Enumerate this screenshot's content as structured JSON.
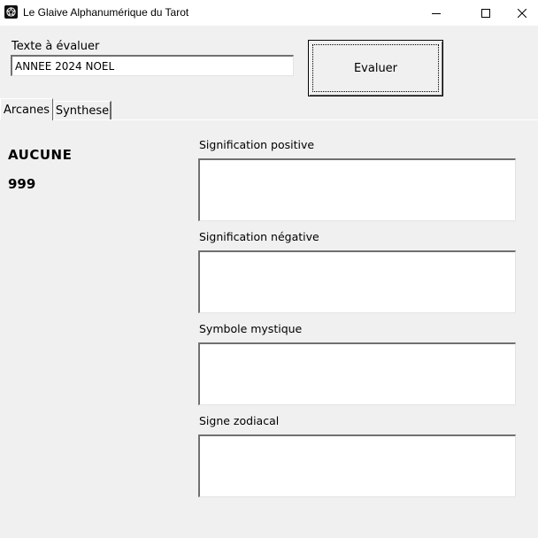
{
  "window": {
    "title": "Le Glaive Alphanumérique du Tarot",
    "icon": "tarot-star-icon",
    "controls": {
      "minimize": "minimize-icon",
      "maximize": "maximize-icon",
      "close": "close-icon"
    }
  },
  "input": {
    "label": "Texte à évaluer",
    "value": "ANNEE 2024 NOEL"
  },
  "evaluate_button": {
    "label": "Evaluer"
  },
  "tabs": [
    {
      "label": "Arcanes",
      "active": true
    },
    {
      "label": "Synthese",
      "active": false
    }
  ],
  "arcane": {
    "name": "AUCUNE",
    "number": "999"
  },
  "sections": {
    "positive": {
      "label": "Signification positive",
      "value": ""
    },
    "negative": {
      "label": "Signification négative",
      "value": ""
    },
    "symbol": {
      "label": "Symbole mystique",
      "value": ""
    },
    "zodiac": {
      "label": "Signe zodiacal",
      "value": ""
    }
  }
}
